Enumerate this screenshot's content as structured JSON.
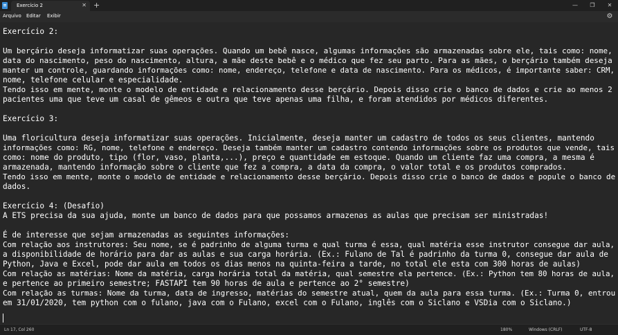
{
  "window": {
    "tab_title": "Exercício 2",
    "tab_close": "✕",
    "new_tab": "+",
    "minimize": "—",
    "maximize": "❐",
    "close": "✕"
  },
  "menu": {
    "items": [
      "Arquivo",
      "Editar",
      "Exibir"
    ]
  },
  "editor": {
    "lines": [
      "Exercício 2:",
      "",
      "Um berçário deseja informatizar suas operações. Quando um bebê nasce, algumas informações são armazenadas sobre ele, tais como: nome,",
      "data do nascimento, peso do nascimento, altura, a mãe deste bebê e o médico que fez seu parto. Para as mães, o berçário também deseja",
      "manter um controle, guardando informações como: nome, endereço, telefone e data de nascimento. Para os médicos, é importante saber: CRM,",
      "nome, telefone celular e especialidade.",
      "Tendo isso em mente, monte o modelo de entidade e relacionamento desse berçário. Depois disso crie o banco de dados e crie ao menos 2",
      "pacientes uma que teve um casal de gêmeos e outra que teve apenas uma filha, e foram atendidos por médicos diferentes.",
      "",
      "Exercício 3:",
      "",
      "Uma floricultura deseja informatizar suas operações. Inicialmente, deseja manter um cadastro de todos os seus clientes, mantendo",
      "informações como: RG, nome, telefone e endereço. Deseja também manter um cadastro contendo informações sobre os produtos que vende, tais",
      "como: nome do produto, tipo (flor, vaso, planta,...), preço e quantidade em estoque. Quando um cliente faz uma compra, a mesma é",
      "armazenada, mantendo informação sobre o cliente que fez a compra, a data da compra, o valor total e os produtos comprados.",
      "Tendo isso em mente, monte o modelo de entidade e relacionamento desse berçário. Depois disso crie o banco de dados e popule o banco de",
      "dados.",
      "",
      "Exercício 4: (Desafio)",
      "A ETS precisa da sua ajuda, monte um banco de dados para que possamos armazenas as aulas que precisam ser ministradas!",
      "",
      "É de interesse que sejam armazenadas as seguintes informações:",
      "Com relação aos instrutores: Seu nome, se é padrinho de alguma turma e qual turma é essa, qual matéria esse instrutor consegue dar aula,",
      "a disponibilidade de horário para dar as aulas e sua carga horária. (Ex.: Fulano de Tal é padrinho da turma 0, consegue dar aula de",
      "Python, Java e Excel, pode dar aula em todos os dias menos na quinta-feira a tarde, no total ele esta com 300 horas de aulas)",
      "Com relação as matérias: Nome da matéria, carga horária total da matéria, qual semestre ela pertence. (Ex.: Python tem 80 horas de aula,",
      "e pertence ao primeiro semestre; FASTAPI tem 90 horas de aula e pertence ao 2° semestre)",
      "Com relação as turmas: Nome da turma, data de ingresso, matérias do semestre atual, quem da aula para essa turma. (Ex.: Turma 0, entrou",
      "em 31/01/2020, tem python com o fulano, java com o Fulano, excel com o Fulano, inglês com o Siclano e VSDia com o Siclano.)",
      ""
    ]
  },
  "status": {
    "position": "Ln 17, Col 260",
    "zoom": "180%",
    "line_ending": "Windows (CRLF)",
    "encoding": "UTF-8"
  }
}
